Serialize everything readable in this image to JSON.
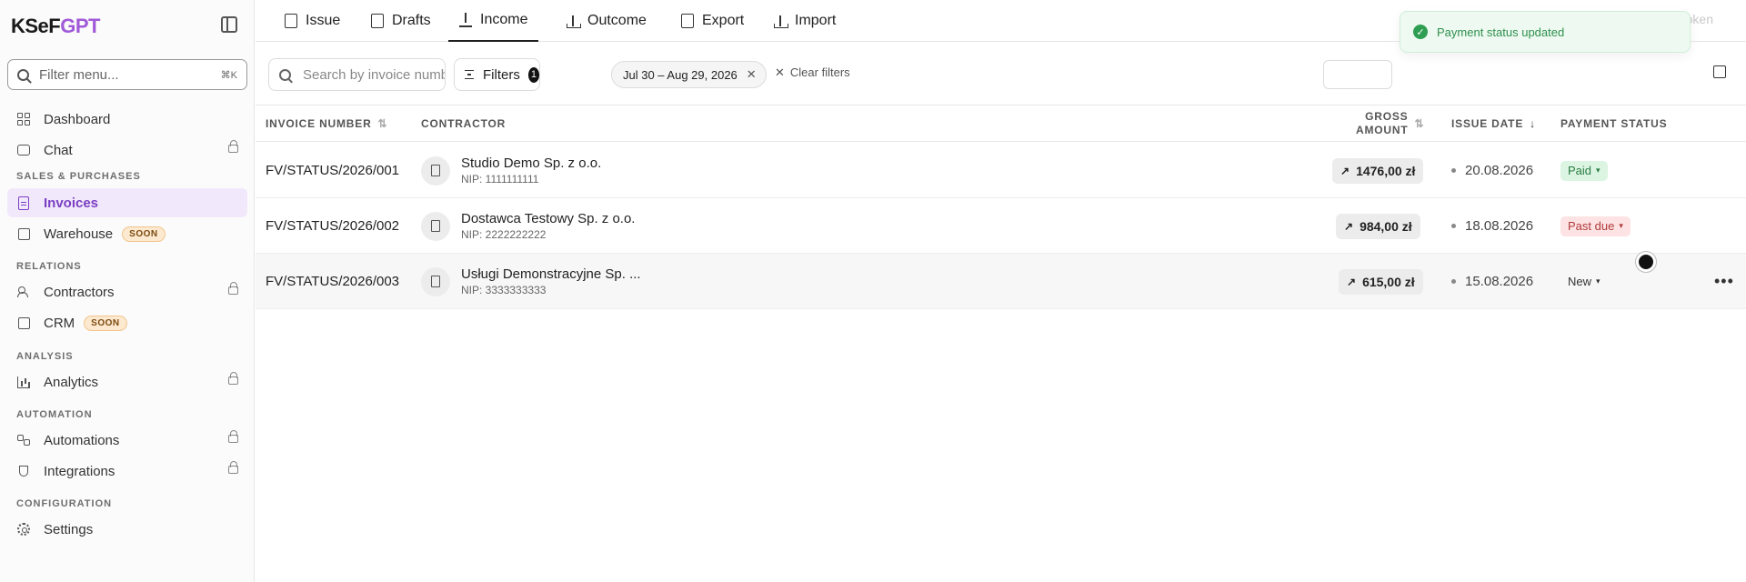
{
  "brand": {
    "part1": "KSeF",
    "part2": "GPT"
  },
  "sidebar": {
    "filter_placeholder": "Filter menu...",
    "filter_shortcut": "⌘K",
    "items": [
      {
        "label": "Dashboard",
        "icon": "dashboard-icon"
      },
      {
        "label": "Chat",
        "icon": "chat-icon",
        "locked": true
      },
      {
        "section": "SALES & PURCHASES"
      },
      {
        "label": "Invoices",
        "icon": "invoice-icon",
        "active": true
      },
      {
        "label": "Warehouse",
        "icon": "box-icon",
        "badge": "SOON"
      },
      {
        "section": "RELATIONS"
      },
      {
        "label": "Contractors",
        "icon": "users-icon",
        "locked": true
      },
      {
        "label": "CRM",
        "icon": "crm-icon",
        "badge": "SOON"
      },
      {
        "section": "ANALYSIS"
      },
      {
        "label": "Analytics",
        "icon": "chart-icon",
        "locked": true
      },
      {
        "section": "AUTOMATION"
      },
      {
        "label": "Automations",
        "icon": "automation-icon",
        "locked": true
      },
      {
        "label": "Integrations",
        "icon": "plug-icon",
        "locked": true
      },
      {
        "section": "CONFIGURATION"
      },
      {
        "label": "Settings",
        "icon": "gear-icon"
      }
    ]
  },
  "tabs": [
    "Issue",
    "Drafts",
    "Income",
    "Outcome",
    "Export",
    "Import"
  ],
  "active_tab": "Income",
  "toast": {
    "message": "Payment status updated",
    "color": "#2e9e52"
  },
  "token_label": "Token",
  "toolbar": {
    "search_placeholder": "Search by invoice number...",
    "filters_label": "Filters",
    "filters_count": "1",
    "date_chip": "Jul 30 – Aug 29, 2026",
    "clear_filters": "Clear filters"
  },
  "table": {
    "headers": {
      "invoice_number": "INVOICE NUMBER",
      "contractor": "CONTRACTOR",
      "gross_amount_1": "GROSS",
      "gross_amount_2": "AMOUNT",
      "issue_date": "ISSUE DATE",
      "payment_status": "PAYMENT STATUS"
    },
    "rows": [
      {
        "invoice": "FV/STATUS/2026/001",
        "contractor": "Studio Demo Sp. z o.o.",
        "nip": "NIP: 1111111111",
        "amount": "1476,00 zł",
        "date": "20.08.2026",
        "status": "Paid"
      },
      {
        "invoice": "FV/STATUS/2026/002",
        "contractor": "Dostawca Testowy Sp. z o.o.",
        "nip": "NIP: 2222222222",
        "amount": "984,00 zł",
        "date": "18.08.2026",
        "status": "Past due"
      },
      {
        "invoice": "FV/STATUS/2026/003",
        "contractor": "Usługi Demonstracyjne Sp. ...",
        "nip": "NIP: 3333333333",
        "amount": "615,00 zł",
        "date": "15.08.2026",
        "status": "New"
      }
    ]
  },
  "colors": {
    "accent": "#7b3fc4",
    "paid": "#2b7c44",
    "past_due": "#b03a3a"
  }
}
